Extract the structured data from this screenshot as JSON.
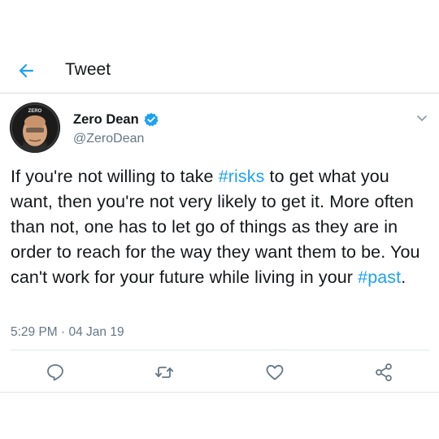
{
  "header": {
    "title": "Tweet"
  },
  "author": {
    "display_name": "Zero Dean",
    "handle": "@ZeroDean",
    "avatar_text": "ZERO",
    "verified": true
  },
  "tweet": {
    "text_parts": [
      "If you're not willing to take ",
      "#risks",
      " to get what you want, then you're not very likely to get it. More often than not, one has to let go of things as they are in order to reach for the way they want them to be. You can't work for your future while living in your ",
      "#past",
      "."
    ],
    "timestamp": "5:29 PM · 04 Jan 19"
  },
  "actions": [
    {
      "name": "reply",
      "icon": "reply-icon"
    },
    {
      "name": "retweet",
      "icon": "retweet-icon"
    },
    {
      "name": "like",
      "icon": "heart-icon"
    },
    {
      "name": "share",
      "icon": "share-icon"
    }
  ],
  "colors": {
    "accent": "#1da1f2",
    "text_primary": "#14171a",
    "text_secondary": "#657786",
    "divider": "#e1e8ed",
    "icon_gray": "#657786"
  }
}
